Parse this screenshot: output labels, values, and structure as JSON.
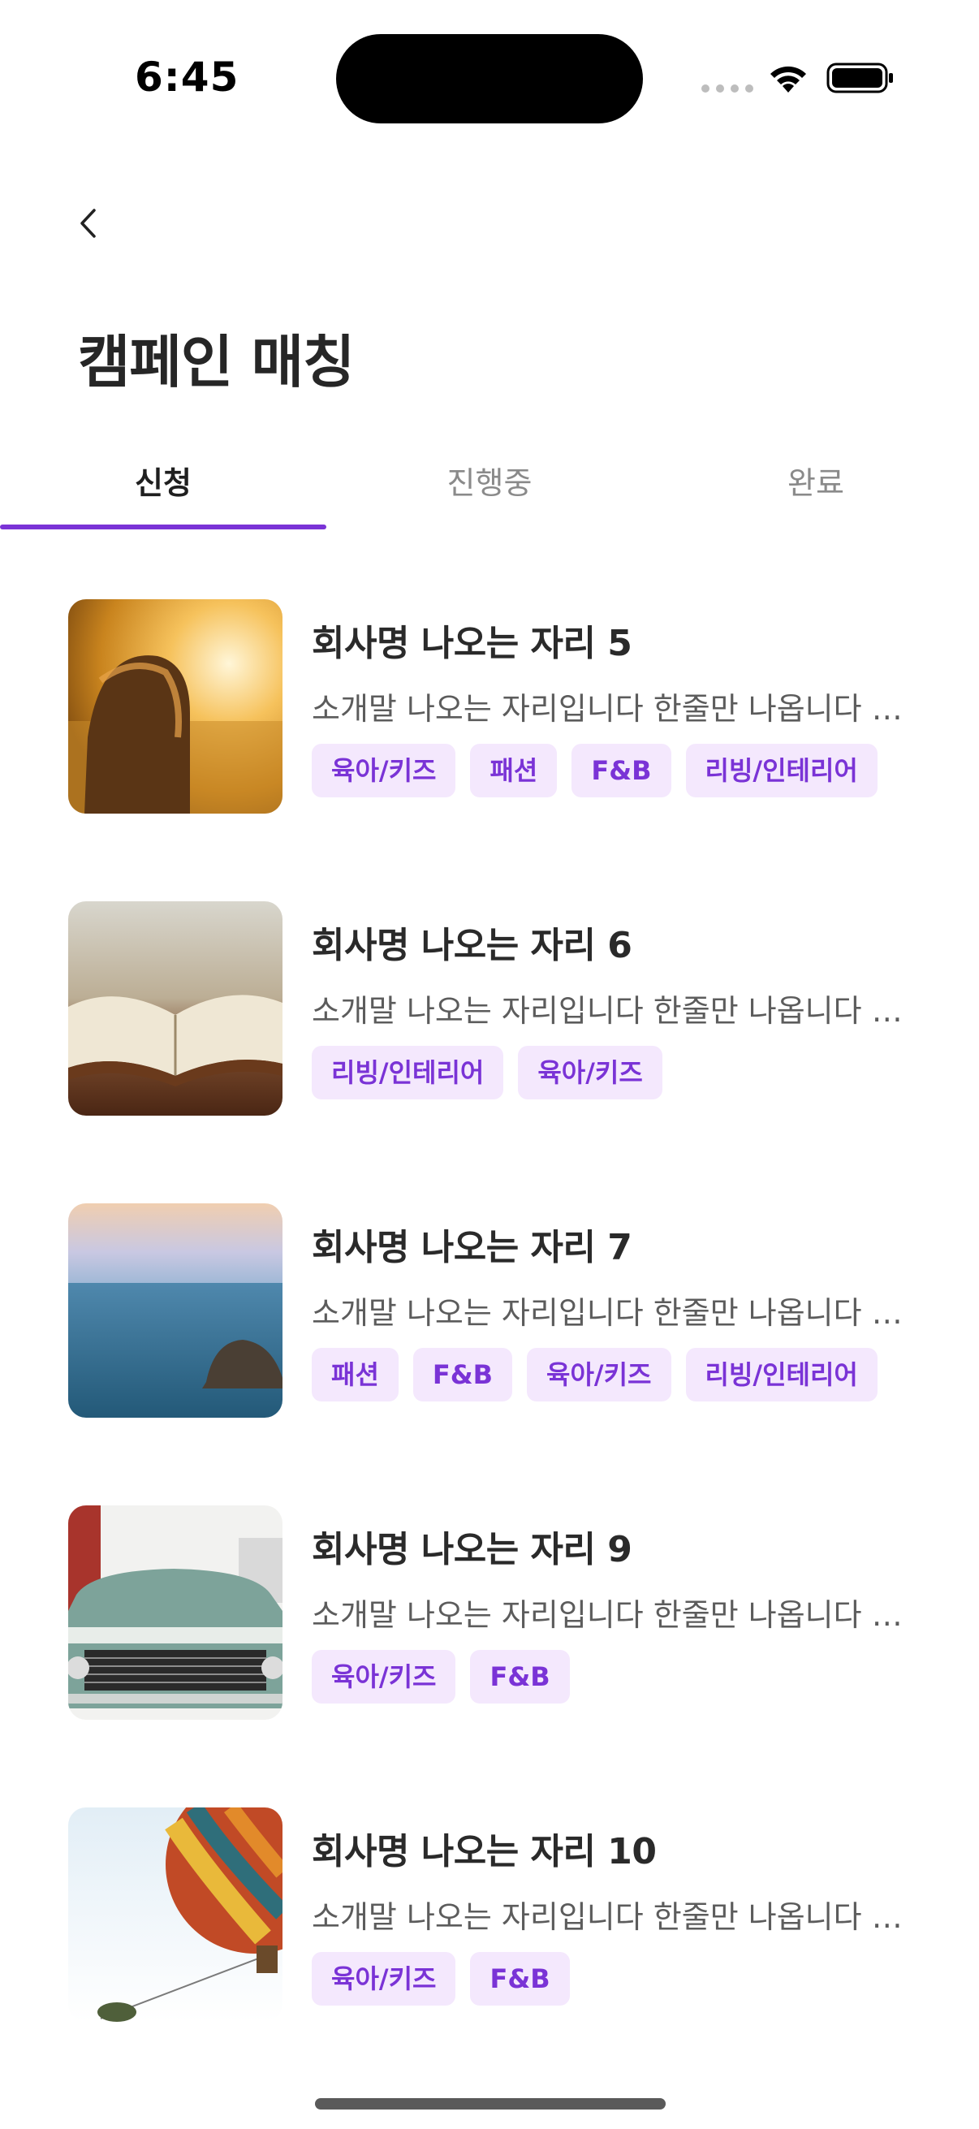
{
  "status_bar": {
    "time": "6:45"
  },
  "header": {
    "title": "캠페인 매칭"
  },
  "tabs": [
    {
      "label": "신청",
      "active": true
    },
    {
      "label": "진행중",
      "active": false
    },
    {
      "label": "완료",
      "active": false
    }
  ],
  "campaigns": [
    {
      "title": "회사명 나오는 자리 5",
      "description": "소개말 나오는 자리입니다 한줄만 나옵니다 더 길어지면",
      "tags": [
        "육아/키즈",
        "패션",
        "F&B",
        "리빙/인테리어"
      ],
      "image": "girl-in-field"
    },
    {
      "title": "회사명 나오는 자리 6",
      "description": "소개말 나오는 자리입니다 한줄만 나옵니다 더 길어지면",
      "tags": [
        "리빙/인테리어",
        "육아/키즈"
      ],
      "image": "open-book"
    },
    {
      "title": "회사명 나오는 자리 7",
      "description": "소개말 나오는 자리입니다 한줄만 나옵니다 더 길어지면",
      "tags": [
        "패션",
        "F&B",
        "육아/키즈",
        "리빙/인테리어"
      ],
      "image": "sea-rock"
    },
    {
      "title": "회사명 나오는 자리 9",
      "description": "소개말 나오는 자리입니다 한줄만 나옵니다 더 길어지면",
      "tags": [
        "육아/키즈",
        "F&B"
      ],
      "image": "vintage-car"
    },
    {
      "title": "회사명 나오는 자리 10",
      "description": "소개말 나오는 자리입니다 한줄만 나옵니다 더 길어지면",
      "tags": [
        "육아/키즈",
        "F&B"
      ],
      "image": "hot-air-balloon"
    }
  ],
  "colors": {
    "accent": "#7a33d6",
    "tag_bg": "#f4e8fd"
  }
}
